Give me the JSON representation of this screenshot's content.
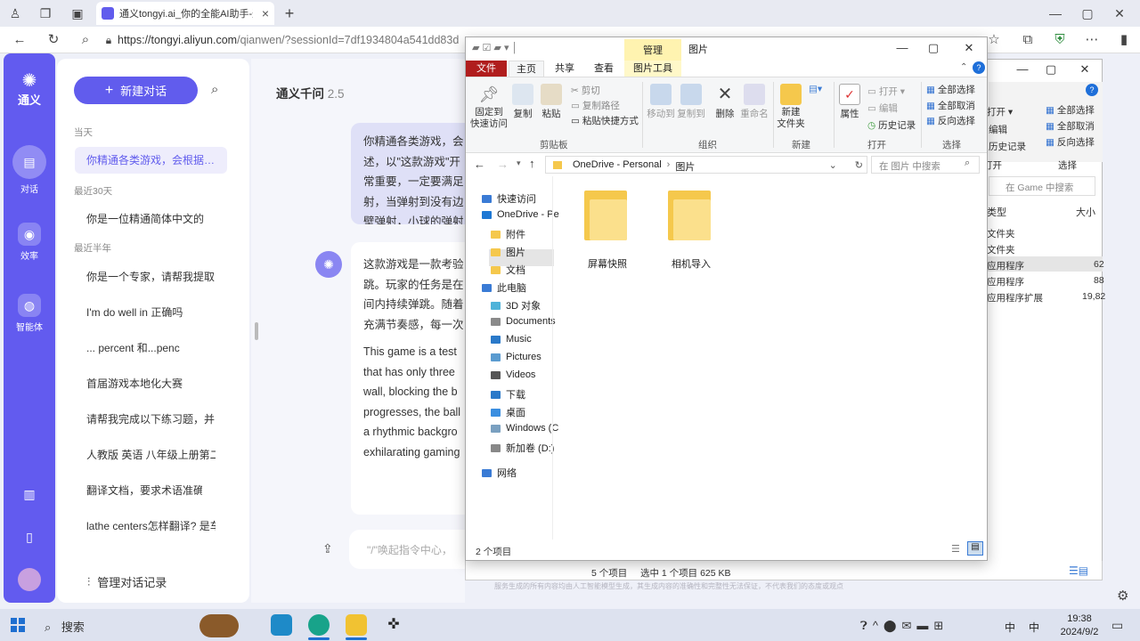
{
  "browser": {
    "tab_title": "通义tongyi.ai_你的全能AI助手-通",
    "new_tab": "+",
    "url_host": "https://tongyi.aliyun.com",
    "url_path": "/qianwen/?sessionId=7df1934804a541dd83d"
  },
  "rail": {
    "logo_label": "通义",
    "items": [
      {
        "label": "对话",
        "icon": "chat-icon"
      },
      {
        "label": "效率",
        "icon": "bulb-icon"
      },
      {
        "label": "智能体",
        "icon": "agent-icon"
      }
    ]
  },
  "sidebar": {
    "new_chat": "新建对话",
    "section_today": "当天",
    "active_item": "你精通各类游戏，会根据…",
    "section_30d": "最近30天",
    "items_30d": [
      "你是一位精通简体中文的"
    ],
    "section_half_year": "最近半年",
    "items_half_year": [
      "你是一个专家，请帮我提取",
      "I'm do well in 正确吗",
      "... percent 和...penc",
      "首届游戏本地化大赛",
      "请帮我完成以下练习题，并",
      "人教版 英语 八年级上册第二",
      "翻译文档，要求术语准确",
      "lathe centers怎样翻译? 是车"
    ],
    "manage": "管理对话记录"
  },
  "chat": {
    "model_name": "通义千问",
    "model_version": "2.5",
    "user_lines": [
      "你精通各类游戏，会",
      "述，以\"这款游戏\"开",
      "常重要，一定要满足",
      "射，当弹射到没有边",
      "壁弹射，小球的弹射"
    ],
    "ai_lines_cn": [
      "这款游戏是一款考验",
      "跳。玩家的任务是在",
      "间内持续弹跳。随着",
      "充满节奏感，每一次"
    ],
    "ai_lines_en": [
      "This game is a test",
      "that has only three",
      "wall, blocking the b",
      "progresses, the ball",
      "a rhythmic backgro",
      "exhilarating gaming"
    ],
    "input_placeholder": "\"/\"唤起指令中心，",
    "disclaimer": "服务生成的所有内容均由人工智能模型生成，其生成内容的准确性和完整性无法保证，不代表我们的态度或观点"
  },
  "explorer": {
    "title": "图片",
    "manage_tab": "管理",
    "tabs": [
      "文件",
      "主页",
      "共享",
      "查看",
      "图片工具"
    ],
    "ribbon": {
      "pin": "固定到\n快速访问",
      "copy": "复制",
      "paste": "粘贴",
      "cut": "剪切",
      "copy_path": "复制路径",
      "paste_shortcut": "粘贴快捷方式",
      "clipboard_group": "剪贴板",
      "move_to": "移动到",
      "copy_to": "复制到",
      "delete": "删除",
      "rename": "重命名",
      "organize_group": "组织",
      "new_folder": "新建\n文件夹",
      "new_group": "新建",
      "properties": "属性",
      "open": "打开",
      "edit": "编辑",
      "history": "历史记录",
      "open_group": "打开",
      "select_all": "全部选择",
      "select_none": "全部取消",
      "invert": "反向选择",
      "select_group": "选择"
    },
    "breadcrumb": [
      "OneDrive - Personal",
      "图片"
    ],
    "search_placeholder": "在 图片 中搜索",
    "tree": [
      {
        "label": "快速访问",
        "color": "#3a7bd5"
      },
      {
        "label": "OneDrive - Pe",
        "color": "#1e78d4"
      },
      {
        "label": "附件",
        "color": "#f5c84c"
      },
      {
        "label": "图片",
        "color": "#f5c84c"
      },
      {
        "label": "文档",
        "color": "#f5c84c"
      },
      {
        "label": "此电脑",
        "color": "#3a7bd5"
      },
      {
        "label": "3D 对象",
        "color": "#4fb3d9"
      },
      {
        "label": "Documents",
        "color": "#8a8a8a"
      },
      {
        "label": "Music",
        "color": "#2a79c9"
      },
      {
        "label": "Pictures",
        "color": "#5a9bd0"
      },
      {
        "label": "Videos",
        "color": "#555"
      },
      {
        "label": "下载",
        "color": "#2a79c9"
      },
      {
        "label": "桌面",
        "color": "#3a8ee0"
      },
      {
        "label": "Windows (C",
        "color": "#7aa0c0"
      },
      {
        "label": "新加卷 (D:)",
        "color": "#888"
      },
      {
        "label": "网络",
        "color": "#3a7bd5"
      }
    ],
    "folders": [
      "屏幕快照",
      "相机导入"
    ],
    "status": "2 个项目"
  },
  "explorer_back": {
    "open": "打开",
    "edit": "编辑",
    "history": "历史记录",
    "select_all": "全部选择",
    "select_none": "全部取消",
    "invert": "反向选择",
    "open_group": "打开",
    "select_group": "选择",
    "search_placeholder": "在 Game 中搜索",
    "col_type": "类型",
    "col_size": "大小",
    "rows": [
      {
        "type": "文件夹",
        "size": ""
      },
      {
        "type": "文件夹",
        "size": ""
      },
      {
        "type": "应用程序",
        "size": "62"
      },
      {
        "type": "应用程序",
        "size": "88"
      },
      {
        "type": "应用程序扩展",
        "size": "19,82"
      }
    ],
    "status_items": "5 个项目",
    "status_selected": "选中 1 个项目  625 KB"
  },
  "taskbar": {
    "search": "搜索",
    "time": "19:38",
    "date": "2024/9/2",
    "ime": "中",
    "lang": "中"
  }
}
